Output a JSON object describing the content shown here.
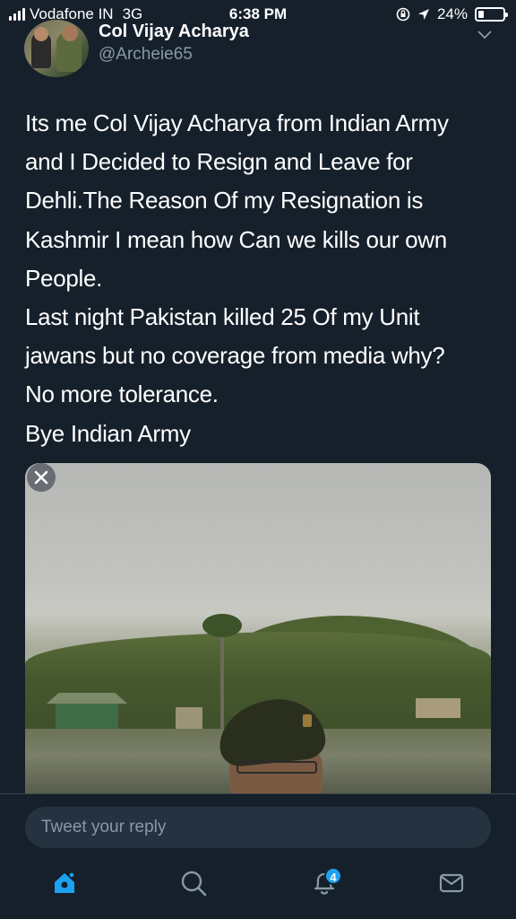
{
  "status_bar": {
    "carrier": "Vodafone IN",
    "network": "3G",
    "time": "6:38 PM",
    "battery": "24%",
    "battery_level": 0.24
  },
  "tweet": {
    "display_name": "Col Vijay Acharya",
    "handle": "@Archeie65",
    "text": "Its me Col Vijay Acharya from Indian Army\nand I Decided to Resign and Leave for\nDehli.The Reason Of my Resignation is\nKashmir I mean how Can we kills our own\nPeople.\nLast night Pakistan killed 25 Of my Unit\njawans but no coverage from media why?\nNo more tolerance.\nBye Indian Army"
  },
  "reply": {
    "placeholder": "Tweet your reply"
  },
  "tab_bar": {
    "notifications_count": "4",
    "icons": [
      "home-icon",
      "search-icon",
      "notifications-icon",
      "messages-icon"
    ]
  },
  "colors": {
    "background": "#15202b",
    "accent": "#1da1f2",
    "secondary_text": "#8899a6"
  }
}
